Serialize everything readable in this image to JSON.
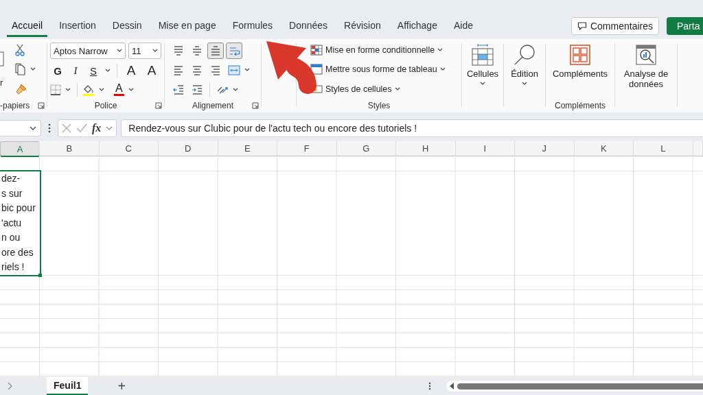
{
  "tabs": [
    {
      "label": "Accueil",
      "selected": true
    },
    {
      "label": "Insertion",
      "selected": false
    },
    {
      "label": "Dessin",
      "selected": false
    },
    {
      "label": "Mise en page",
      "selected": false
    },
    {
      "label": "Formules",
      "selected": false
    },
    {
      "label": "Données",
      "selected": false
    },
    {
      "label": "Révision",
      "selected": false
    },
    {
      "label": "Affichage",
      "selected": false
    },
    {
      "label": "Aide",
      "selected": false
    }
  ],
  "comments_button": "Commentaires",
  "share_button": "Parta",
  "clipboard": {
    "paste_label": "r",
    "group_label": "-papiers"
  },
  "font": {
    "name": "Aptos Narrow",
    "size": "11",
    "bold": "G",
    "italic": "I",
    "underline": "S",
    "grow": "A",
    "shrink": "A",
    "font_color": "A",
    "group_label": "Police"
  },
  "alignment": {
    "group_label": "Alignement",
    "buttons": [
      {
        "kind": "top",
        "selected": false
      },
      {
        "kind": "middle",
        "selected": false
      },
      {
        "kind": "bottom",
        "selected": true
      },
      {
        "kind": "wrap",
        "selected": true
      },
      {
        "kind": "left",
        "selected": false
      },
      {
        "kind": "center",
        "selected": false
      },
      {
        "kind": "right",
        "selected": false
      },
      {
        "kind": "merge",
        "selected": false
      },
      {
        "kind": "outdent",
        "selected": false
      },
      {
        "kind": "indent",
        "selected": false
      },
      {
        "kind": "orientation",
        "selected": false
      }
    ]
  },
  "styles": {
    "items": [
      "Mise en forme conditionnelle",
      "Mettre sous forme de tableau",
      "Styles de cellules"
    ],
    "group_label": "Styles"
  },
  "cells_button": "Cellules",
  "editing_button": "Édition",
  "addins": {
    "button": "Compléments",
    "group_label": "Compléments"
  },
  "analyze_button": "Analyse de données",
  "formula_bar": {
    "fx": "fx",
    "content": "Rendez-vous sur Clubic pour de l'actu tech ou encore des tutoriels !"
  },
  "columns": [
    {
      "label": "A",
      "selected": true
    },
    {
      "label": "B",
      "selected": false
    },
    {
      "label": "C",
      "selected": false
    },
    {
      "label": "D",
      "selected": false
    },
    {
      "label": "E",
      "selected": false
    },
    {
      "label": "F",
      "selected": false
    },
    {
      "label": "G",
      "selected": false
    },
    {
      "label": "H",
      "selected": false
    },
    {
      "label": "I",
      "selected": false
    },
    {
      "label": "J",
      "selected": false
    },
    {
      "label": "K",
      "selected": false
    },
    {
      "label": "L",
      "selected": false
    }
  ],
  "active_cell_lines": [
    "dez-",
    "s sur",
    "bic pour",
    "'actu",
    "n ou",
    "ore des",
    "riels !"
  ],
  "sheet_tabs": [
    {
      "label": "Feuil1",
      "selected": true
    }
  ],
  "add_sheet": "+"
}
